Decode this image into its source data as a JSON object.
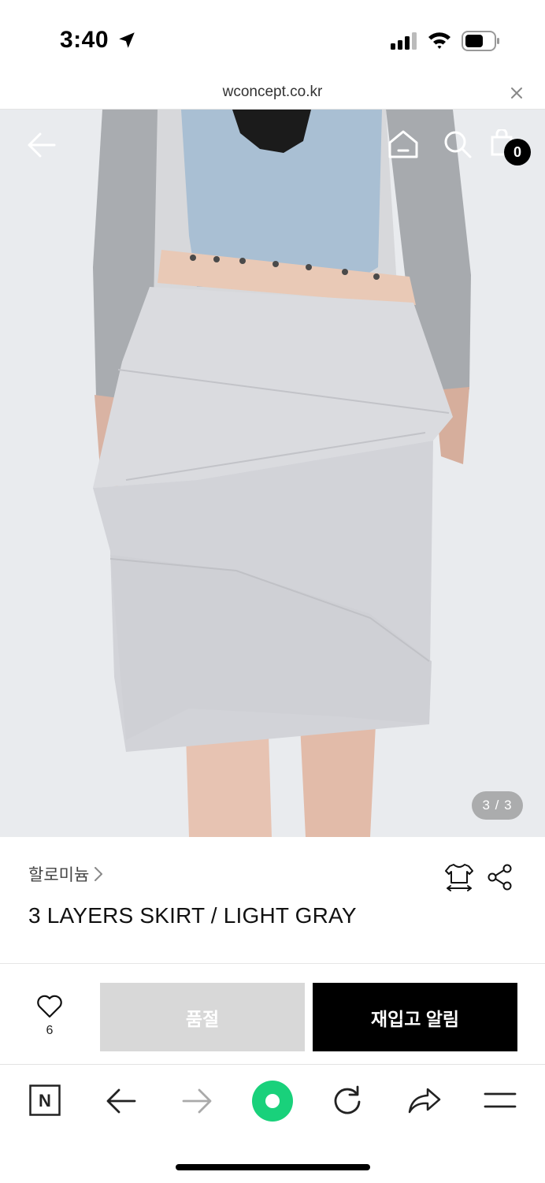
{
  "status_bar": {
    "time": "3:40"
  },
  "browser": {
    "url": "wconcept.co.kr"
  },
  "hero": {
    "cart_count": "0",
    "page_indicator": "3 / 3"
  },
  "product": {
    "brand": "할로미늄",
    "title": "3 LAYERS SKIRT / LIGHT GRAY"
  },
  "actions": {
    "wishlist_count": "6",
    "sold_out_label": "품절",
    "restock_label": "재입고 알림"
  },
  "toolbar": {
    "naver_letter": "N"
  },
  "colors": {
    "accent_green": "#19d17b",
    "sold_out_bg": "#d8d8d8",
    "primary_button_bg": "#000000"
  }
}
